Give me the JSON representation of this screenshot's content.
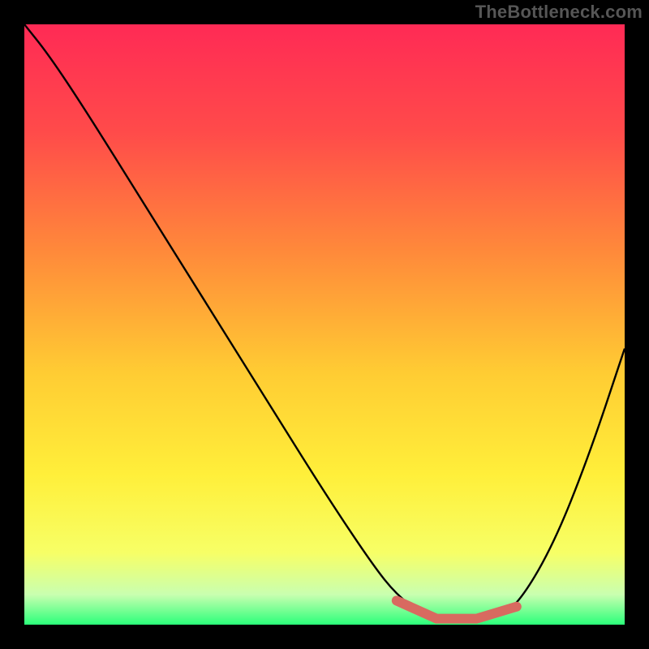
{
  "attribution": "TheBottleneck.com",
  "colors": {
    "gradient_stops": [
      {
        "offset": "0%",
        "color": "#ff2a55"
      },
      {
        "offset": "18%",
        "color": "#ff4b4a"
      },
      {
        "offset": "38%",
        "color": "#ff8a3a"
      },
      {
        "offset": "58%",
        "color": "#ffcc33"
      },
      {
        "offset": "75%",
        "color": "#ffef3a"
      },
      {
        "offset": "88%",
        "color": "#f7ff66"
      },
      {
        "offset": "95%",
        "color": "#c9ffb0"
      },
      {
        "offset": "100%",
        "color": "#2bff7a"
      }
    ],
    "curve": "#000000",
    "highlight": "#d86a60",
    "frame": "#000000"
  },
  "chart_data": {
    "type": "line",
    "title": "",
    "xlabel": "",
    "ylabel": "",
    "xlim": [
      0,
      100
    ],
    "ylim": [
      0,
      100
    ],
    "series": [
      {
        "name": "bottleneck_curve",
        "x": [
          0,
          4,
          10,
          20,
          30,
          40,
          50,
          58,
          62,
          66,
          72,
          78,
          82,
          88,
          94,
          100
        ],
        "y": [
          100,
          95,
          86,
          70,
          54,
          38,
          22,
          10,
          5,
          2,
          1,
          1,
          3,
          13,
          28,
          46
        ]
      }
    ],
    "highlight_range": {
      "x": [
        62,
        82
      ],
      "y": [
        4,
        1,
        1,
        3
      ]
    }
  }
}
